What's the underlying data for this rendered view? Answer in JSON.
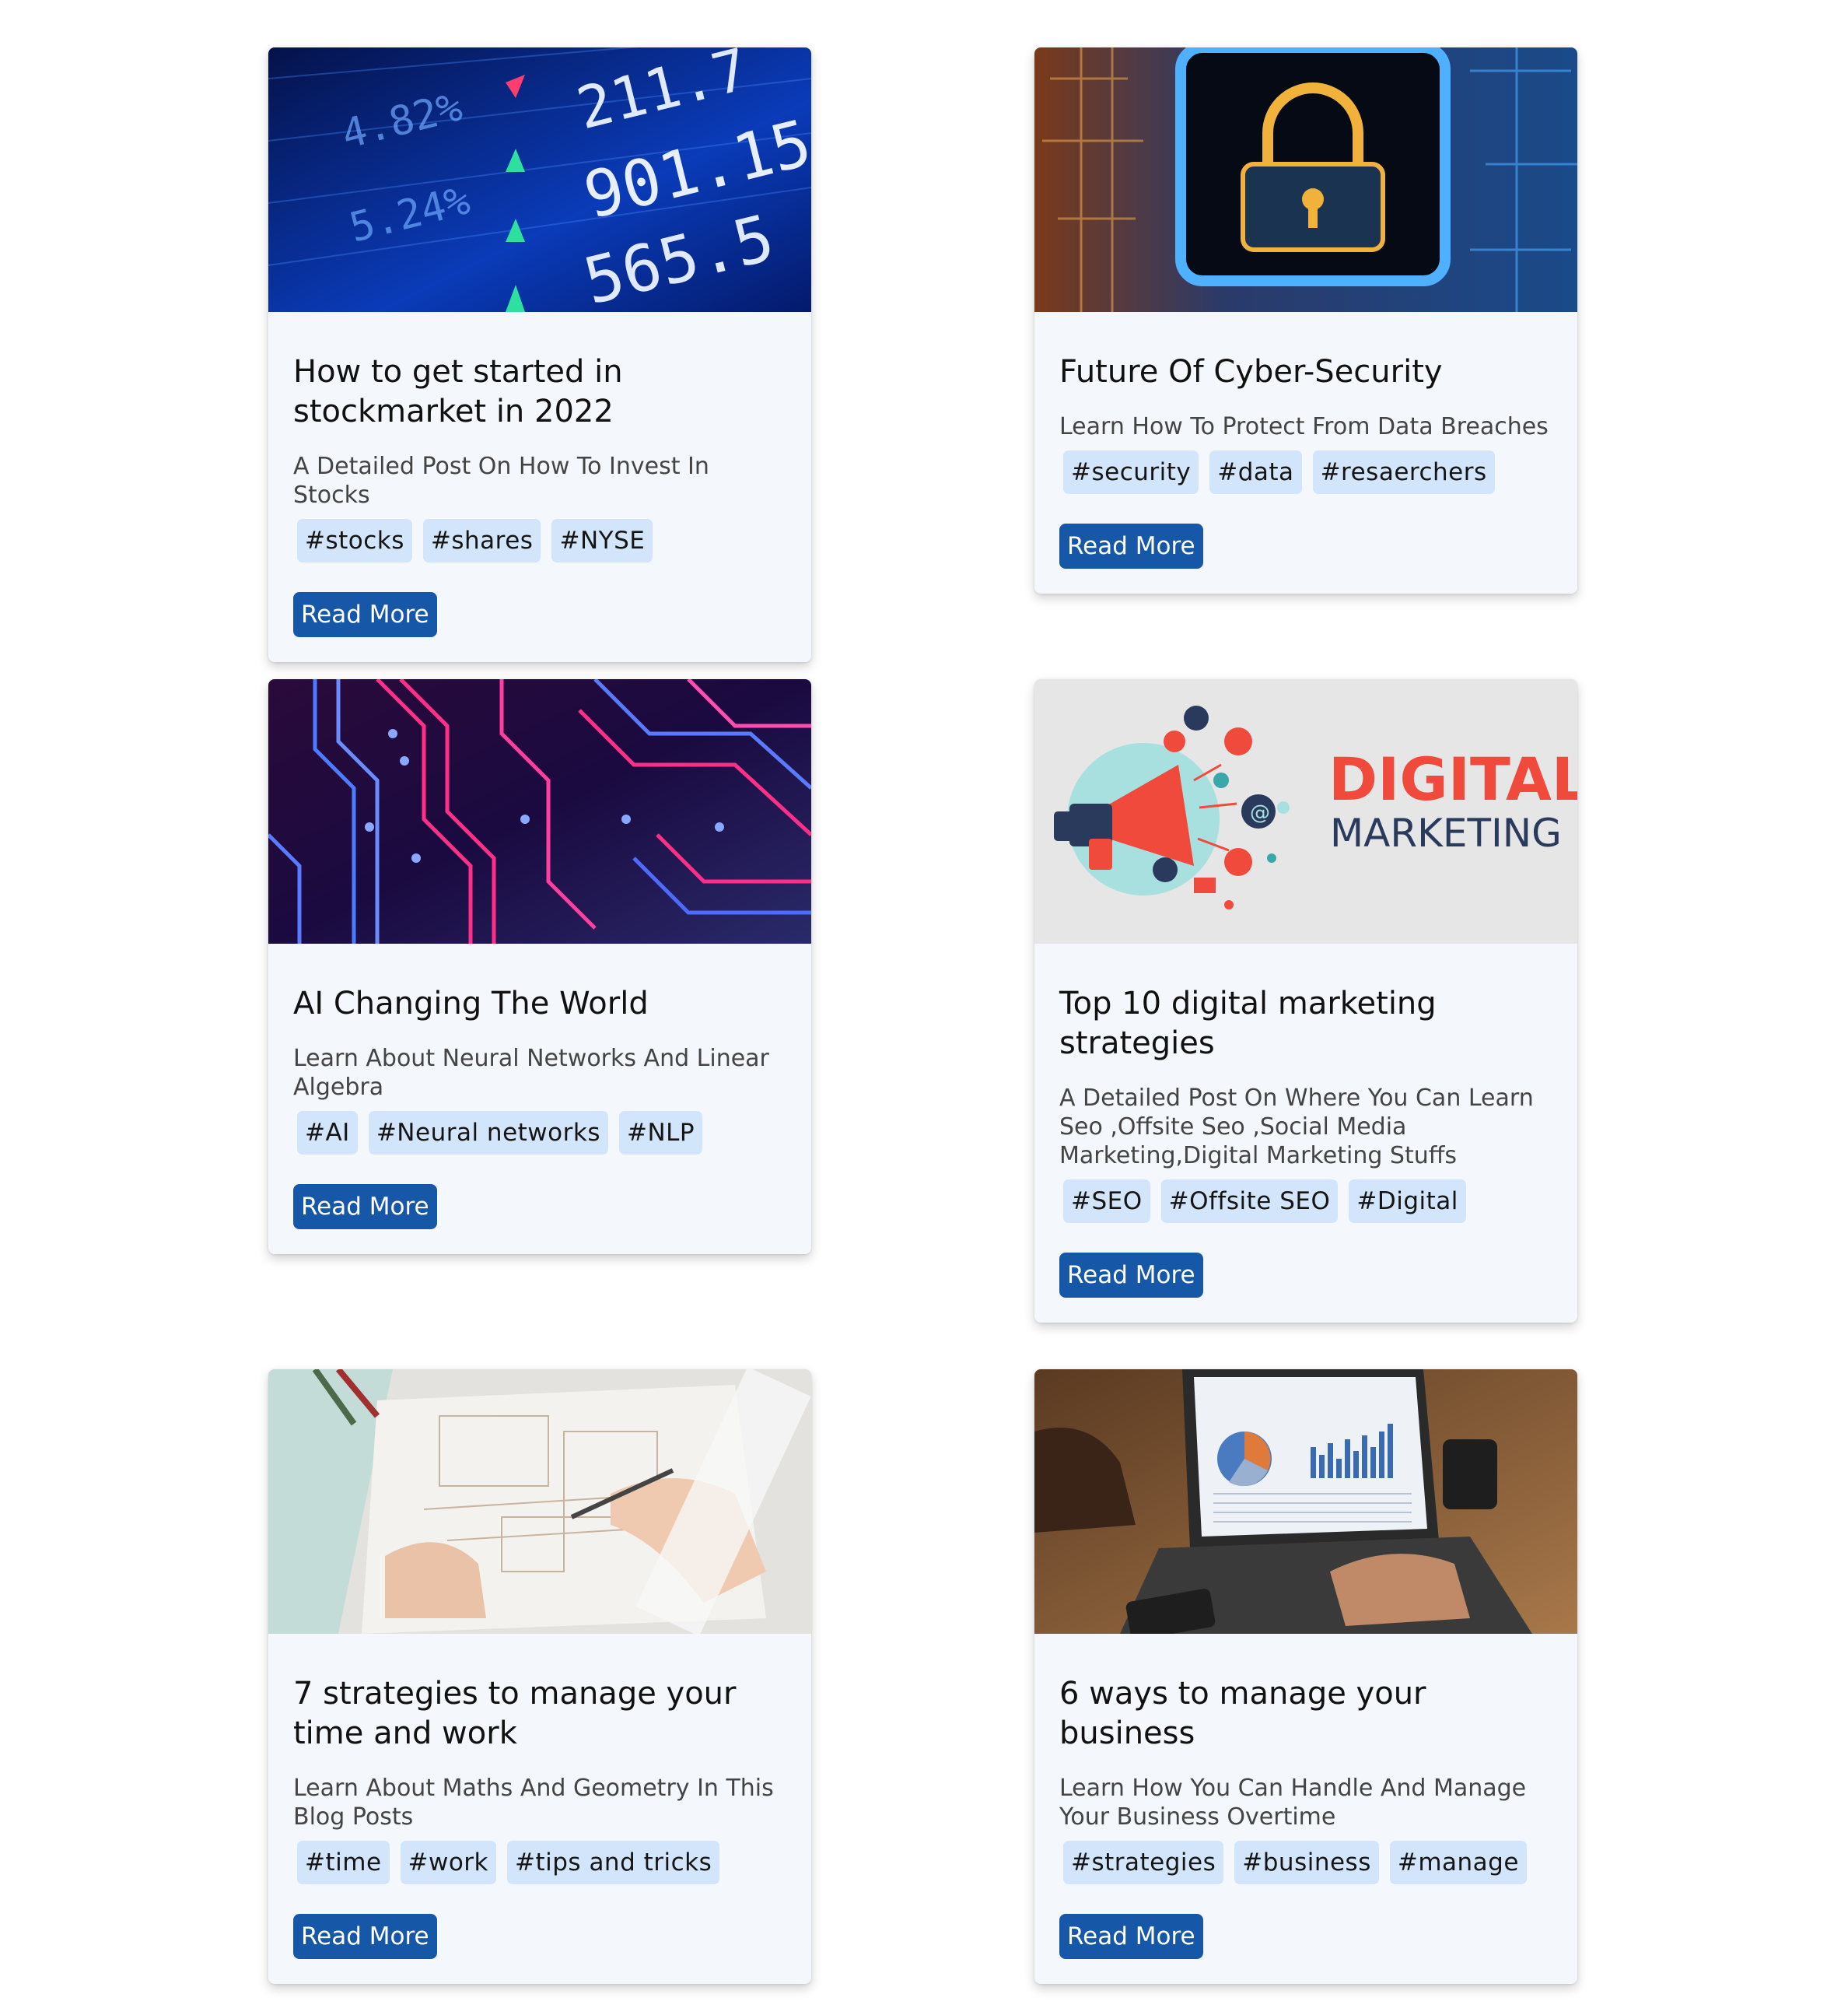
{
  "cards": [
    {
      "title": "How to get started in stockmarket in 2022",
      "description": "A Detailed Post On How To Invest In Stocks",
      "tags": [
        "#stocks",
        "#shares",
        "#NYSE"
      ],
      "button": "Read More",
      "image": {
        "alt": "stock market ticker",
        "numbers": [
          "211.7",
          "901.15",
          "565.5"
        ],
        "percents": [
          "4.82%",
          "5.24%"
        ]
      }
    },
    {
      "title": "Future Of Cyber-Security",
      "description": "Learn How To Protect From Data Breaches",
      "tags": [
        "#security",
        "#data",
        "#resaerchers"
      ],
      "button": "Read More",
      "image": {
        "alt": "padlock on circuit board"
      }
    },
    {
      "title": "AI Changing The World",
      "description": "Learn About Neural Networks And Linear Algebra",
      "tags": [
        "#AI",
        "#Neural networks",
        "#NLP"
      ],
      "button": "Read More",
      "image": {
        "alt": "neon circuit traces"
      }
    },
    {
      "title": "Top 10 digital marketing strategies",
      "description": "A Detailed Post On Where You Can Learn Seo ,Offsite Seo ,Social Media Marketing,Digital Marketing Stuffs",
      "tags": [
        "#SEO",
        "#Offsite SEO",
        "#Digital"
      ],
      "button": "Read More",
      "image": {
        "alt": "digital marketing megaphone",
        "line1": "DIGITAL",
        "line2": "MARKETING"
      }
    },
    {
      "title": "7 strategies to manage your time and work",
      "description": "Learn About Maths And Geometry In This Blog Posts",
      "tags": [
        "#time",
        "#work",
        "#tips and tricks"
      ],
      "button": "Read More",
      "image": {
        "alt": "architect sketching on desk"
      }
    },
    {
      "title": "6 ways to manage your business",
      "description": "Learn How You Can Handle And Manage Your Business Overtime",
      "tags": [
        "#strategies",
        "#business",
        "#manage"
      ],
      "button": "Read More",
      "image": {
        "alt": "laptop with charts on wooden desk"
      }
    }
  ],
  "colors": {
    "button": "#1757a8",
    "tag": "#d3e5fb",
    "card": "#f4f7fc",
    "marketing_red": "#ef4a3c",
    "marketing_navy": "#2a3a5c"
  }
}
